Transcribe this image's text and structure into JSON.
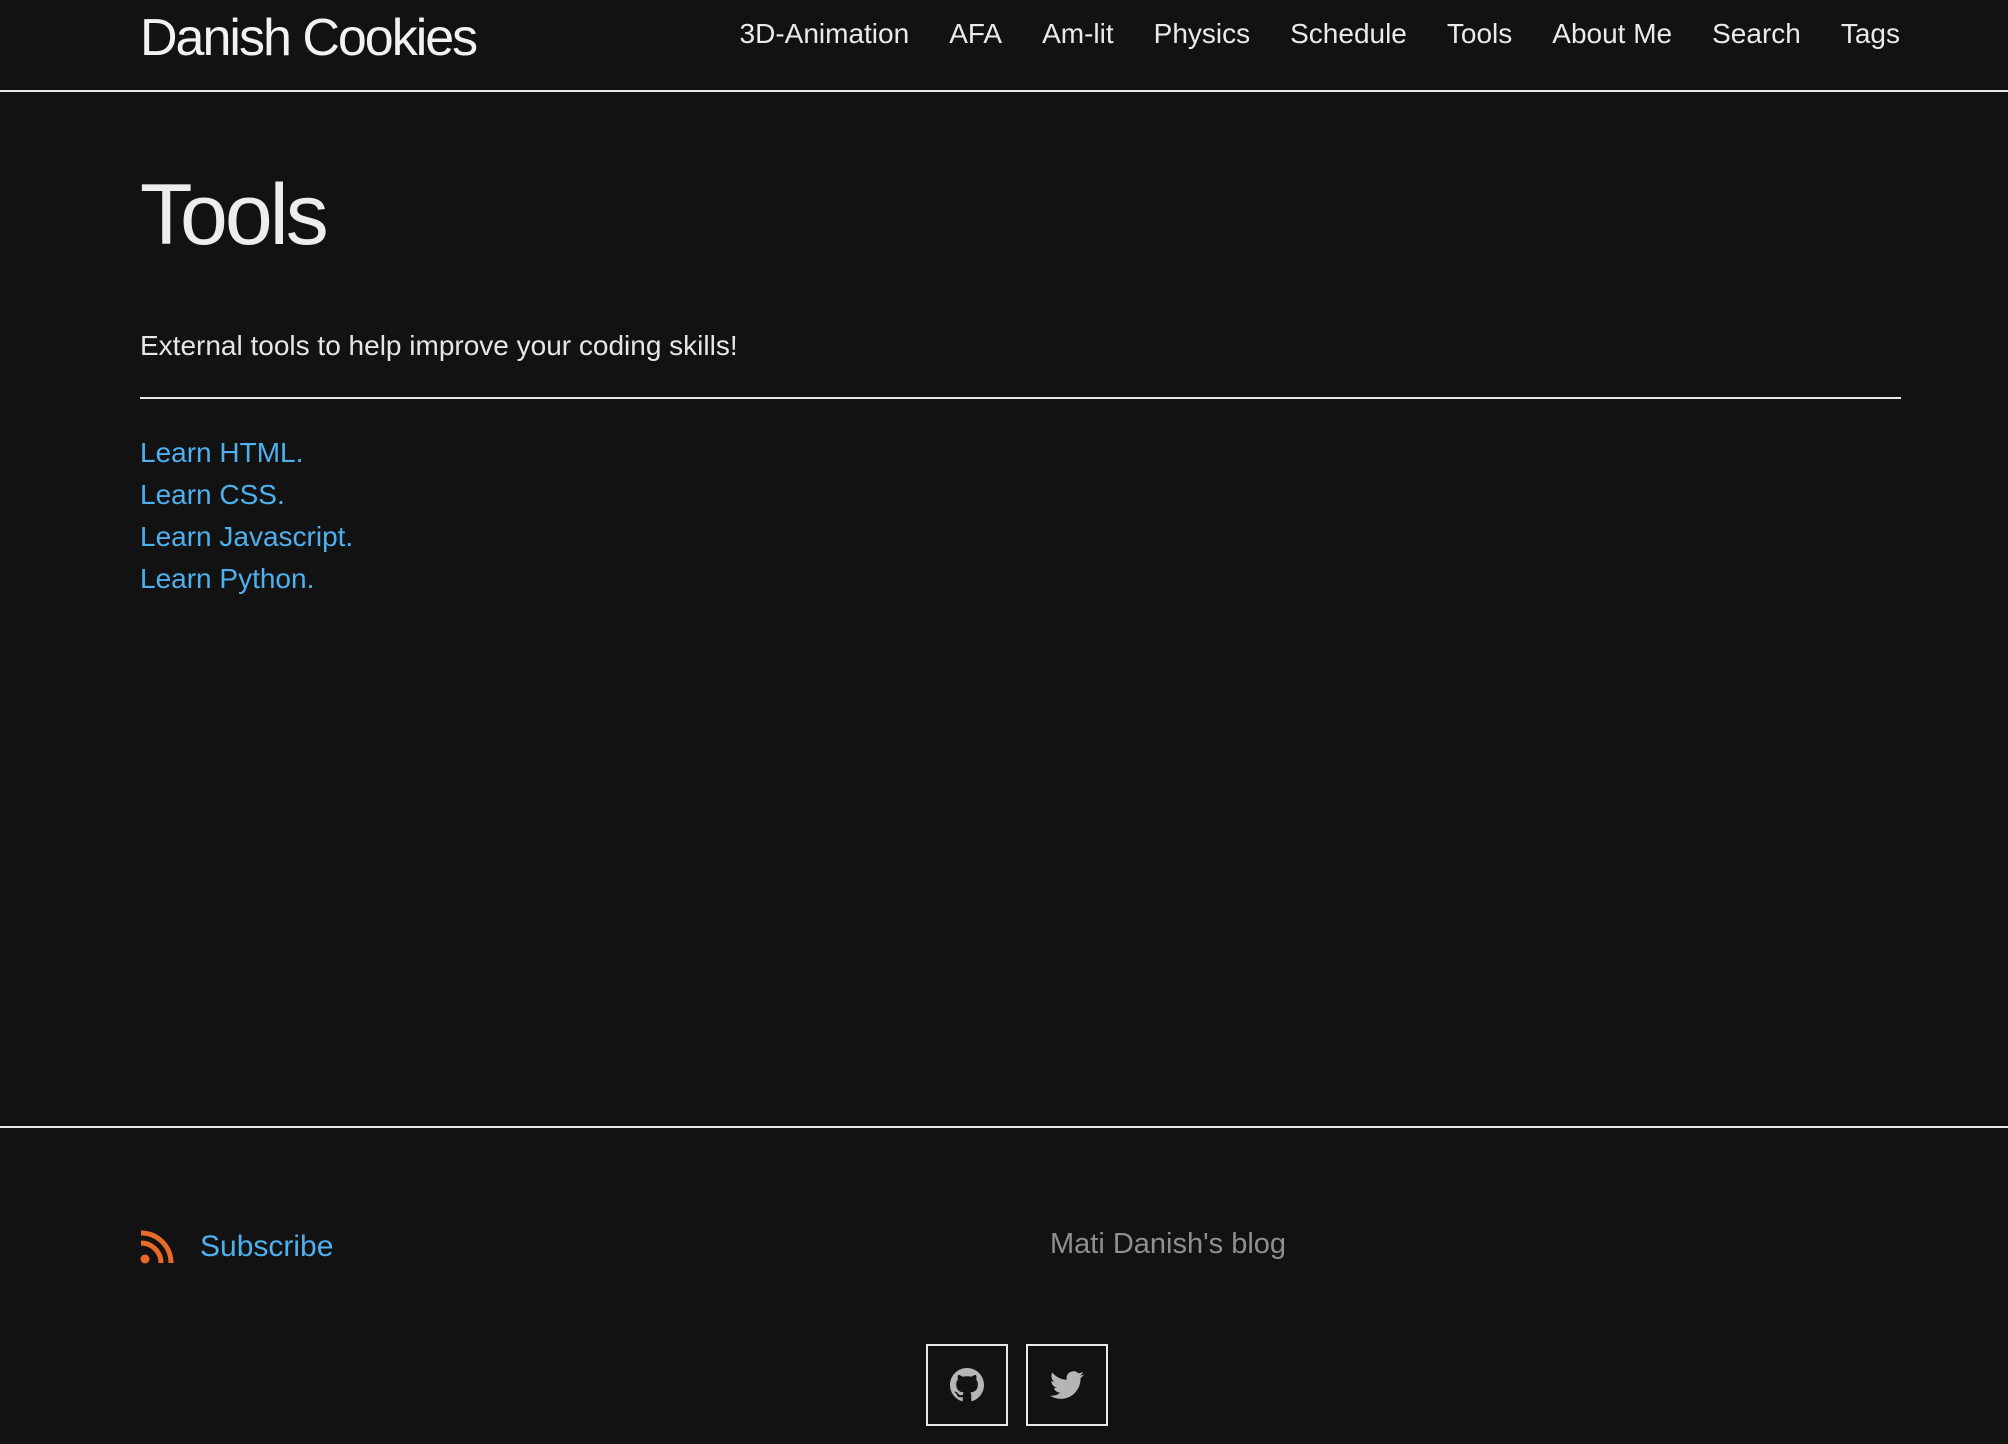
{
  "header": {
    "brand": "Danish Cookies",
    "nav": [
      {
        "label": "3D-Animation"
      },
      {
        "label": "AFA"
      },
      {
        "label": "Am-lit"
      },
      {
        "label": "Physics"
      },
      {
        "label": "Schedule"
      },
      {
        "label": "Tools"
      },
      {
        "label": "About Me"
      },
      {
        "label": "Search"
      },
      {
        "label": "Tags"
      }
    ]
  },
  "main": {
    "title": "Tools",
    "lead": "External tools to help improve your coding skills!",
    "links": [
      {
        "label": "Learn HTML."
      },
      {
        "label": "Learn CSS."
      },
      {
        "label": "Learn Javascript."
      },
      {
        "label": "Learn Python."
      }
    ]
  },
  "footer": {
    "subscribe_label": "Subscribe",
    "subscribe_icon": "rss-icon",
    "credit": "Mati Danish's blog",
    "social": [
      {
        "icon": "github-icon"
      },
      {
        "icon": "twitter-icon"
      }
    ]
  },
  "colors": {
    "background": "#121212",
    "text": "#e6e6e6",
    "link": "#4fb0f0",
    "rss": "#e8692a",
    "muted": "#8f8f8f"
  }
}
